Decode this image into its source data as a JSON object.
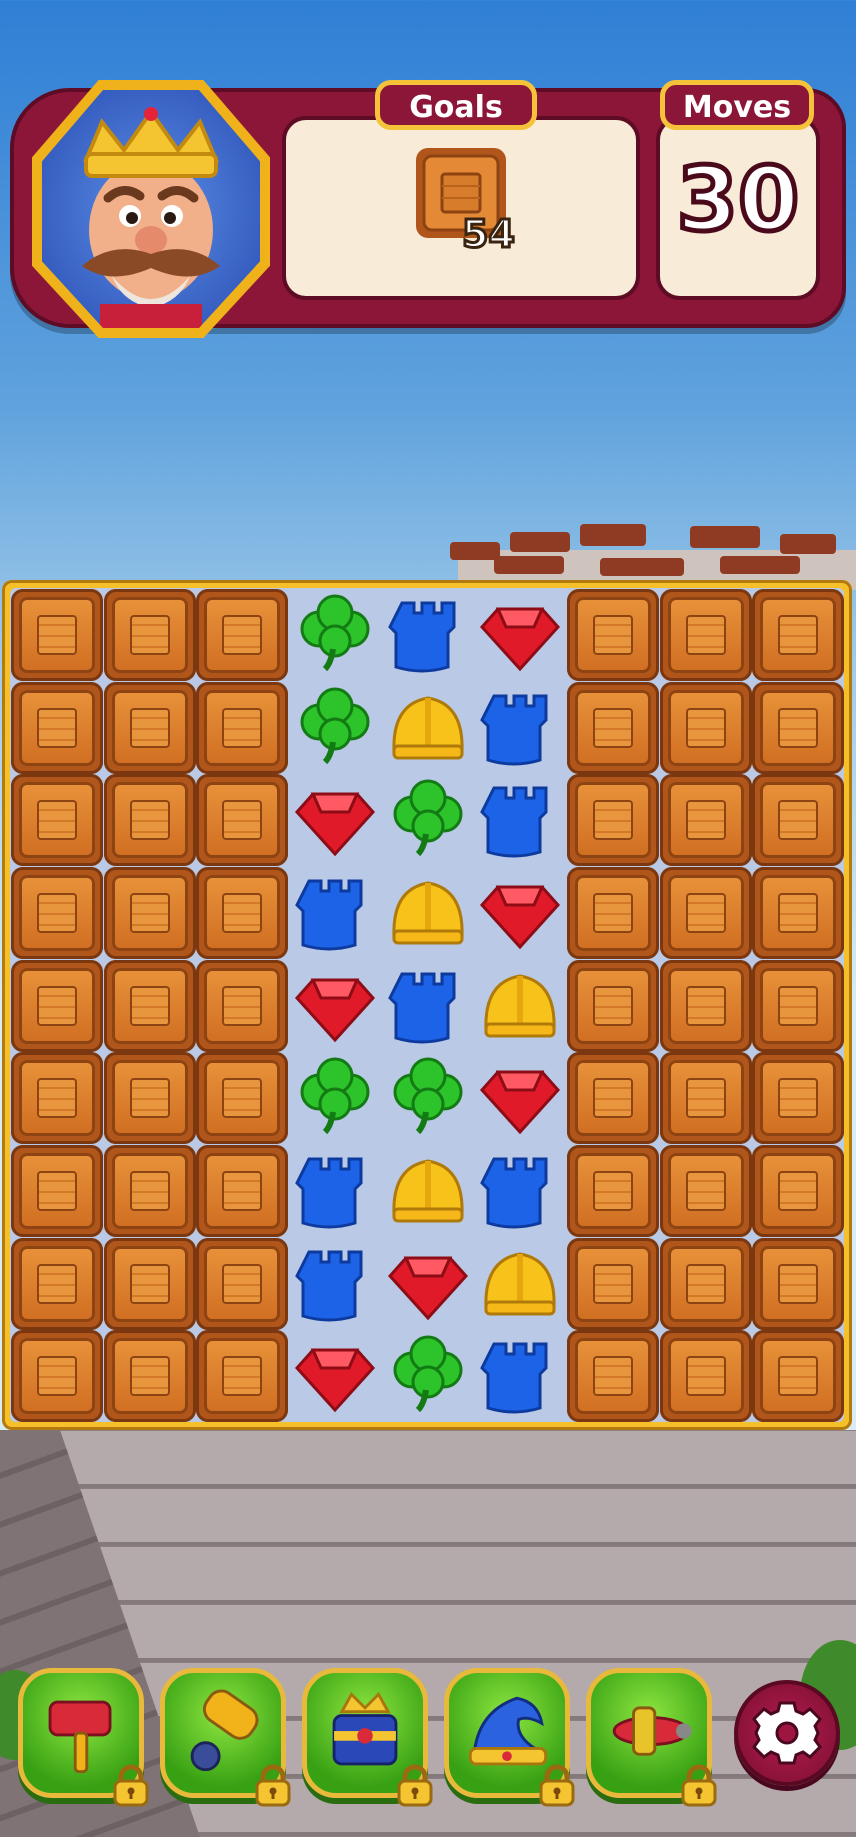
{
  "hud": {
    "goals_label": "Goals",
    "moves_label": "Moves",
    "moves_value": "30",
    "goal": {
      "icon": "wooden-crate-icon",
      "count": "54"
    },
    "avatar": "king-avatar"
  },
  "board": {
    "rows": 9,
    "cols": 9,
    "grid": [
      [
        "crate",
        "crate",
        "crate",
        "clover",
        "tower",
        "gem",
        "crate",
        "crate",
        "crate"
      ],
      [
        "crate",
        "crate",
        "crate",
        "clover",
        "helmet",
        "tower",
        "crate",
        "crate",
        "crate"
      ],
      [
        "crate",
        "crate",
        "crate",
        "gem",
        "clover",
        "tower",
        "crate",
        "crate",
        "crate"
      ],
      [
        "crate",
        "crate",
        "crate",
        "tower",
        "helmet",
        "gem",
        "crate",
        "crate",
        "crate"
      ],
      [
        "crate",
        "crate",
        "crate",
        "gem",
        "tower",
        "helmet",
        "crate",
        "crate",
        "crate"
      ],
      [
        "crate",
        "crate",
        "crate",
        "clover",
        "clover",
        "gem",
        "crate",
        "crate",
        "crate"
      ],
      [
        "crate",
        "crate",
        "crate",
        "tower",
        "helmet",
        "tower",
        "crate",
        "crate",
        "crate"
      ],
      [
        "crate",
        "crate",
        "crate",
        "tower",
        "gem",
        "helmet",
        "crate",
        "crate",
        "crate"
      ],
      [
        "crate",
        "crate",
        "crate",
        "gem",
        "clover",
        "tower",
        "crate",
        "crate",
        "crate"
      ]
    ],
    "colors": {
      "clover": "#2cc42a",
      "tower": "#1d63e8",
      "gem": "#e11a2a",
      "helmet": "#f7c21a",
      "crate": "#d9782a"
    }
  },
  "boosters": [
    {
      "name": "hammer-booster",
      "icon": "hammer-icon",
      "locked": true
    },
    {
      "name": "cannon-booster",
      "icon": "cannon-icon",
      "locked": true
    },
    {
      "name": "royal-booster",
      "icon": "crown-box-icon",
      "locked": true
    },
    {
      "name": "jester-hat-booster",
      "icon": "jester-hat-icon",
      "locked": true
    },
    {
      "name": "plane-booster",
      "icon": "plane-icon",
      "locked": true
    }
  ],
  "settings": {
    "icon": "gear-icon"
  }
}
